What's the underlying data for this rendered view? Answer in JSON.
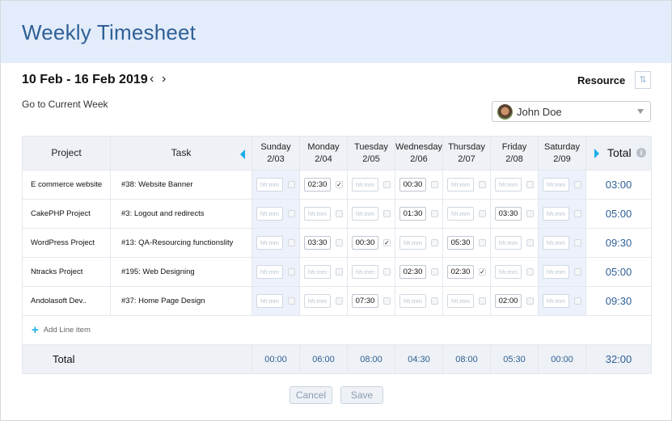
{
  "header": {
    "title": "Weekly Timesheet"
  },
  "week": {
    "range": "10 Feb - 16 Feb 2019",
    "prev_icon": "chevron-left",
    "next_icon": "chevron-right",
    "go_current": "Go to Current Week"
  },
  "resource": {
    "label": "Resource",
    "sort_icon": "⇅",
    "selected": "John Doe"
  },
  "table": {
    "headers": {
      "project": "Project",
      "task": "Task",
      "total": "Total",
      "info_icon": "i"
    },
    "days": [
      {
        "name": "Sunday",
        "date": "2/03"
      },
      {
        "name": "Monday",
        "date": "2/04"
      },
      {
        "name": "Tuesday",
        "date": "2/05"
      },
      {
        "name": "Wednesday",
        "date": "2/06"
      },
      {
        "name": "Thursday",
        "date": "2/07"
      },
      {
        "name": "Friday",
        "date": "2/08"
      },
      {
        "name": "Saturday",
        "date": "2/09"
      }
    ],
    "placeholder": "hh:mm",
    "rows": [
      {
        "project": "E commerce website",
        "task": "#38:  Website Banner",
        "entries": [
          {
            "value": "",
            "checked": false
          },
          {
            "value": "02:30",
            "checked": true
          },
          {
            "value": "",
            "checked": false
          },
          {
            "value": "00:30",
            "checked": false
          },
          {
            "value": "",
            "checked": false
          },
          {
            "value": "",
            "checked": false
          },
          {
            "value": "",
            "checked": false
          }
        ],
        "total": "03:00"
      },
      {
        "project": "CakePHP Project",
        "task": "#3:  Logout and redirects",
        "entries": [
          {
            "value": "",
            "checked": false
          },
          {
            "value": "",
            "checked": false
          },
          {
            "value": "",
            "checked": false
          },
          {
            "value": "01:30",
            "checked": false
          },
          {
            "value": "",
            "checked": false
          },
          {
            "value": "03:30",
            "checked": false
          },
          {
            "value": "",
            "checked": false
          }
        ],
        "total": "05:00"
      },
      {
        "project": "WordPress Project",
        "task": "#13:  QA-Resourcing functionslity",
        "entries": [
          {
            "value": "",
            "checked": false
          },
          {
            "value": "03:30",
            "checked": false
          },
          {
            "value": "00:30",
            "checked": true
          },
          {
            "value": "",
            "checked": false
          },
          {
            "value": "05:30",
            "checked": false
          },
          {
            "value": "",
            "checked": false
          },
          {
            "value": "",
            "checked": false
          }
        ],
        "total": "09:30"
      },
      {
        "project": "Ntracks Project",
        "task": "#195:  Web Designing",
        "entries": [
          {
            "value": "",
            "checked": false
          },
          {
            "value": "",
            "checked": false
          },
          {
            "value": "",
            "checked": false
          },
          {
            "value": "02:30",
            "checked": false
          },
          {
            "value": "02:30",
            "checked": true
          },
          {
            "value": "",
            "checked": false
          },
          {
            "value": "",
            "checked": false
          }
        ],
        "total": "05:00"
      },
      {
        "project": "Andolasoft Dev..",
        "task": "#37:  Home Page Design",
        "entries": [
          {
            "value": "",
            "checked": false
          },
          {
            "value": "",
            "checked": false
          },
          {
            "value": "07:30",
            "checked": false
          },
          {
            "value": "",
            "checked": false
          },
          {
            "value": "",
            "checked": false
          },
          {
            "value": "02:00",
            "checked": false
          },
          {
            "value": "",
            "checked": false
          }
        ],
        "total": "09:30"
      }
    ],
    "add_line": "Add Line item",
    "totals": {
      "label": "Total",
      "days": [
        "00:00",
        "06:00",
        "08:00",
        "04:30",
        "08:00",
        "05:30",
        "00:00"
      ],
      "grand": "32:00"
    }
  },
  "buttons": {
    "cancel": "Cancel",
    "save": "Save"
  },
  "colors": {
    "accent": "#17aee8",
    "title": "#2f6096",
    "header_bg": "#e3ecfb"
  }
}
